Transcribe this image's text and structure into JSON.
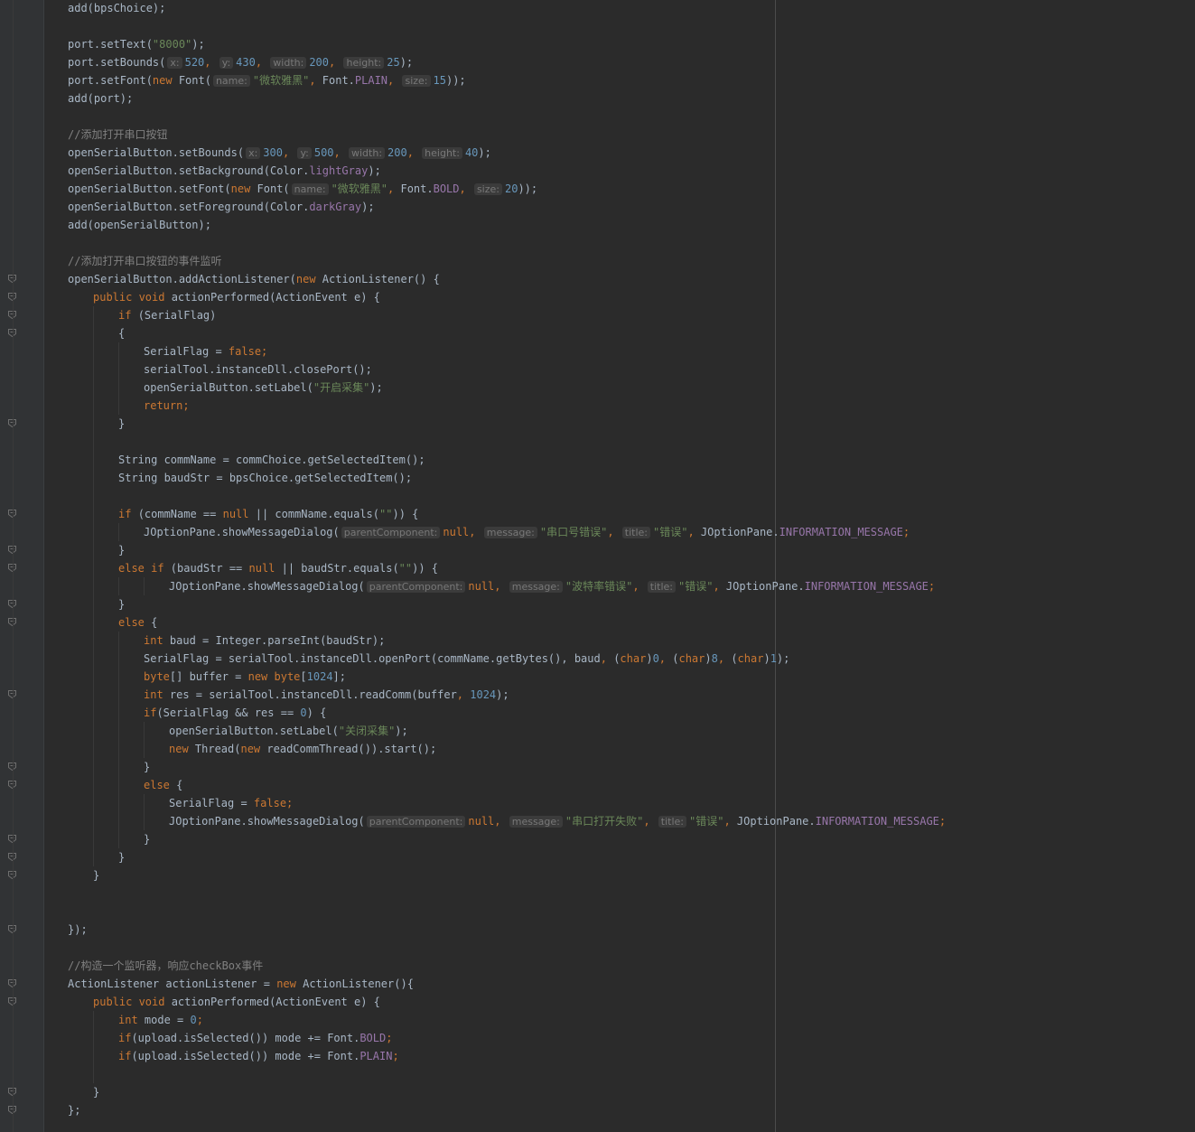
{
  "editor": {
    "theme": "Darcula",
    "colors": {
      "background": "#2b2b2b",
      "gutter": "#313335",
      "keyword": "#cc7832",
      "field": "#9876aa",
      "string": "#6a8759",
      "number": "#6897bb",
      "comment": "#808080",
      "default": "#a9b7c6"
    },
    "fold_icon": "fold-marker-icon"
  },
  "lines": [
    [
      [
        "d",
        "add(bpsChoice);"
      ]
    ],
    [],
    [
      [
        "d",
        "port.setText("
      ],
      [
        "s",
        "\"8000\""
      ],
      [
        "d",
        ");"
      ]
    ],
    [
      [
        "d",
        "port.setBounds("
      ],
      [
        "h",
        "x:"
      ],
      [
        "n",
        "520"
      ],
      [
        "k",
        ", "
      ],
      [
        "h",
        "y:"
      ],
      [
        "n",
        "430"
      ],
      [
        "k",
        ", "
      ],
      [
        "h",
        "width:"
      ],
      [
        "n",
        "200"
      ],
      [
        "k",
        ", "
      ],
      [
        "h",
        "height:"
      ],
      [
        "n",
        "25"
      ],
      [
        "d",
        ");"
      ]
    ],
    [
      [
        "d",
        "port.setFont("
      ],
      [
        "k",
        "new "
      ],
      [
        "d",
        "Font("
      ],
      [
        "h",
        "name:"
      ],
      [
        "s",
        "\"微软雅黑\""
      ],
      [
        "k",
        ", "
      ],
      [
        "d",
        "Font."
      ],
      [
        "m",
        "PLAIN"
      ],
      [
        "k",
        ", "
      ],
      [
        "h",
        "size:"
      ],
      [
        "n",
        "15"
      ],
      [
        "d",
        "));"
      ]
    ],
    [
      [
        "d",
        "add(port);"
      ]
    ],
    [],
    [
      [
        "c",
        "//添加打开串口按钮"
      ]
    ],
    [
      [
        "d",
        "openSerialButton.setBounds("
      ],
      [
        "h",
        "x:"
      ],
      [
        "n",
        "300"
      ],
      [
        "k",
        ", "
      ],
      [
        "h",
        "y:"
      ],
      [
        "n",
        "500"
      ],
      [
        "k",
        ", "
      ],
      [
        "h",
        "width:"
      ],
      [
        "n",
        "200"
      ],
      [
        "k",
        ", "
      ],
      [
        "h",
        "height:"
      ],
      [
        "n",
        "40"
      ],
      [
        "d",
        ");"
      ]
    ],
    [
      [
        "d",
        "openSerialButton.setBackground(Color."
      ],
      [
        "m",
        "lightGray"
      ],
      [
        "d",
        ");"
      ]
    ],
    [
      [
        "d",
        "openSerialButton.setFont("
      ],
      [
        "k",
        "new "
      ],
      [
        "d",
        "Font("
      ],
      [
        "h",
        "name:"
      ],
      [
        "s",
        "\"微软雅黑\""
      ],
      [
        "k",
        ", "
      ],
      [
        "d",
        "Font."
      ],
      [
        "m",
        "BOLD"
      ],
      [
        "k",
        ", "
      ],
      [
        "h",
        "size:"
      ],
      [
        "n",
        "20"
      ],
      [
        "d",
        "));"
      ]
    ],
    [
      [
        "d",
        "openSerialButton.setForeground(Color."
      ],
      [
        "m",
        "darkGray"
      ],
      [
        "d",
        ");"
      ]
    ],
    [
      [
        "d",
        "add(openSerialButton);"
      ]
    ],
    [],
    [
      [
        "c",
        "//添加打开串口按钮的事件监听"
      ]
    ],
    [
      [
        "d",
        "openSerialButton.addActionListener("
      ],
      [
        "k",
        "new "
      ],
      [
        "d",
        "ActionListener() {"
      ]
    ],
    [
      [
        "k",
        "public void "
      ],
      [
        "d",
        "actionPerformed(ActionEvent e) {"
      ]
    ],
    [
      [
        "k",
        "if "
      ],
      [
        "d",
        "(SerialFlag)"
      ]
    ],
    [
      [
        "d",
        "{"
      ]
    ],
    [
      [
        "d",
        "SerialFlag = "
      ],
      [
        "k",
        "false;"
      ]
    ],
    [
      [
        "d",
        "serialTool.instanceDll.closePort();"
      ]
    ],
    [
      [
        "d",
        "openSerialButton.setLabel("
      ],
      [
        "s",
        "\"开启采集\""
      ],
      [
        "d",
        ");"
      ]
    ],
    [
      [
        "k",
        "return;"
      ]
    ],
    [
      [
        "d",
        "}"
      ]
    ],
    [],
    [
      [
        "d",
        "String commName = commChoice.getSelectedItem();"
      ]
    ],
    [
      [
        "d",
        "String baudStr = bpsChoice.getSelectedItem();"
      ]
    ],
    [],
    [
      [
        "k",
        "if "
      ],
      [
        "d",
        "(commName == "
      ],
      [
        "k",
        "null "
      ],
      [
        "d",
        "|| commName.equals("
      ],
      [
        "s",
        "\"\""
      ],
      [
        "d",
        ")) {"
      ]
    ],
    [
      [
        "d",
        "JOptionPane.showMessageDialog("
      ],
      [
        "h",
        "parentComponent:"
      ],
      [
        "k",
        "null, "
      ],
      [
        "h",
        "message:"
      ],
      [
        "s",
        "\"串口号错误\""
      ],
      [
        "k",
        ", "
      ],
      [
        "h",
        "title:"
      ],
      [
        "s",
        "\"错误\""
      ],
      [
        "k",
        ", "
      ],
      [
        "d",
        "JOptionPane."
      ],
      [
        "m",
        "INFORMATION_MESSAGE"
      ],
      [
        "k",
        ";"
      ]
    ],
    [
      [
        "d",
        "}"
      ]
    ],
    [
      [
        "k",
        "else if "
      ],
      [
        "d",
        "(baudStr == "
      ],
      [
        "k",
        "null "
      ],
      [
        "d",
        "|| baudStr.equals("
      ],
      [
        "s",
        "\"\""
      ],
      [
        "d",
        ")) {"
      ]
    ],
    [
      [
        "d",
        "JOptionPane.showMessageDialog("
      ],
      [
        "h",
        "parentComponent:"
      ],
      [
        "k",
        "null, "
      ],
      [
        "h",
        "message:"
      ],
      [
        "s",
        "\"波特率错误\""
      ],
      [
        "k",
        ", "
      ],
      [
        "h",
        "title:"
      ],
      [
        "s",
        "\"错误\""
      ],
      [
        "k",
        ", "
      ],
      [
        "d",
        "JOptionPane."
      ],
      [
        "m",
        "INFORMATION_MESSAGE"
      ],
      [
        "k",
        ";"
      ]
    ],
    [
      [
        "d",
        "}"
      ]
    ],
    [
      [
        "k",
        "else "
      ],
      [
        "d",
        "{"
      ]
    ],
    [
      [
        "k",
        "int "
      ],
      [
        "d",
        "baud = Integer.parseInt(baudStr);"
      ]
    ],
    [
      [
        "d",
        "SerialFlag = serialTool.instanceDll.openPort(commName.getBytes(), baud"
      ],
      [
        "k",
        ", "
      ],
      [
        "d",
        "("
      ],
      [
        "k",
        "char"
      ],
      [
        "d",
        ")"
      ],
      [
        "n",
        "0"
      ],
      [
        "k",
        ", "
      ],
      [
        "d",
        "("
      ],
      [
        "k",
        "char"
      ],
      [
        "d",
        ")"
      ],
      [
        "n",
        "8"
      ],
      [
        "k",
        ", "
      ],
      [
        "d",
        "("
      ],
      [
        "k",
        "char"
      ],
      [
        "d",
        ")"
      ],
      [
        "n",
        "1"
      ],
      [
        "d",
        ");"
      ]
    ],
    [
      [
        "k",
        "byte"
      ],
      [
        "d",
        "[] buffer = "
      ],
      [
        "k",
        "new byte"
      ],
      [
        "d",
        "["
      ],
      [
        "n",
        "1024"
      ],
      [
        "d",
        "];"
      ]
    ],
    [
      [
        "k",
        "int "
      ],
      [
        "d",
        "res = serialTool.instanceDll.readComm(buffer"
      ],
      [
        "k",
        ", "
      ],
      [
        "n",
        "1024"
      ],
      [
        "d",
        ");"
      ]
    ],
    [
      [
        "k",
        "if"
      ],
      [
        "d",
        "(SerialFlag && res == "
      ],
      [
        "n",
        "0"
      ],
      [
        "d",
        ") {"
      ]
    ],
    [
      [
        "d",
        "openSerialButton.setLabel("
      ],
      [
        "s",
        "\"关闭采集\""
      ],
      [
        "d",
        ");"
      ]
    ],
    [
      [
        "k",
        "new "
      ],
      [
        "d",
        "Thread("
      ],
      [
        "k",
        "new "
      ],
      [
        "d",
        "readCommThread()).start();"
      ]
    ],
    [
      [
        "d",
        "}"
      ]
    ],
    [
      [
        "k",
        "else "
      ],
      [
        "d",
        "{"
      ]
    ],
    [
      [
        "d",
        "SerialFlag = "
      ],
      [
        "k",
        "false;"
      ]
    ],
    [
      [
        "d",
        "JOptionPane.showMessageDialog("
      ],
      [
        "h",
        "parentComponent:"
      ],
      [
        "k",
        "null, "
      ],
      [
        "h",
        "message:"
      ],
      [
        "s",
        "\"串口打开失败\""
      ],
      [
        "k",
        ", "
      ],
      [
        "h",
        "title:"
      ],
      [
        "s",
        "\"错误\""
      ],
      [
        "k",
        ", "
      ],
      [
        "d",
        "JOptionPane."
      ],
      [
        "m",
        "INFORMATION_MESSAGE"
      ],
      [
        "k",
        ";"
      ]
    ],
    [
      [
        "d",
        "}"
      ]
    ],
    [
      [
        "d",
        "}"
      ]
    ],
    [
      [
        "d",
        "}"
      ]
    ],
    [],
    [],
    [
      [
        "d",
        "});"
      ]
    ],
    [],
    [
      [
        "c",
        "//构造一个监听器，响应checkBox事件"
      ]
    ],
    [
      [
        "d",
        "ActionListener actionListener = "
      ],
      [
        "k",
        "new "
      ],
      [
        "d",
        "ActionListener(){"
      ]
    ],
    [
      [
        "k",
        "public void "
      ],
      [
        "d",
        "actionPerformed(ActionEvent e) {"
      ]
    ],
    [
      [
        "k",
        "int "
      ],
      [
        "d",
        "mode = "
      ],
      [
        "n",
        "0"
      ],
      [
        "k",
        ";"
      ]
    ],
    [
      [
        "k",
        "if"
      ],
      [
        "d",
        "(upload.isSelected()) mode += Font."
      ],
      [
        "m",
        "BOLD"
      ],
      [
        "k",
        ";"
      ]
    ],
    [
      [
        "k",
        "if"
      ],
      [
        "d",
        "(upload.isSelected()) mode += Font."
      ],
      [
        "m",
        "PLAIN"
      ],
      [
        "k",
        ";"
      ]
    ],
    [],
    [
      [
        "d",
        "}"
      ]
    ],
    [
      [
        "d",
        "};"
      ]
    ]
  ]
}
